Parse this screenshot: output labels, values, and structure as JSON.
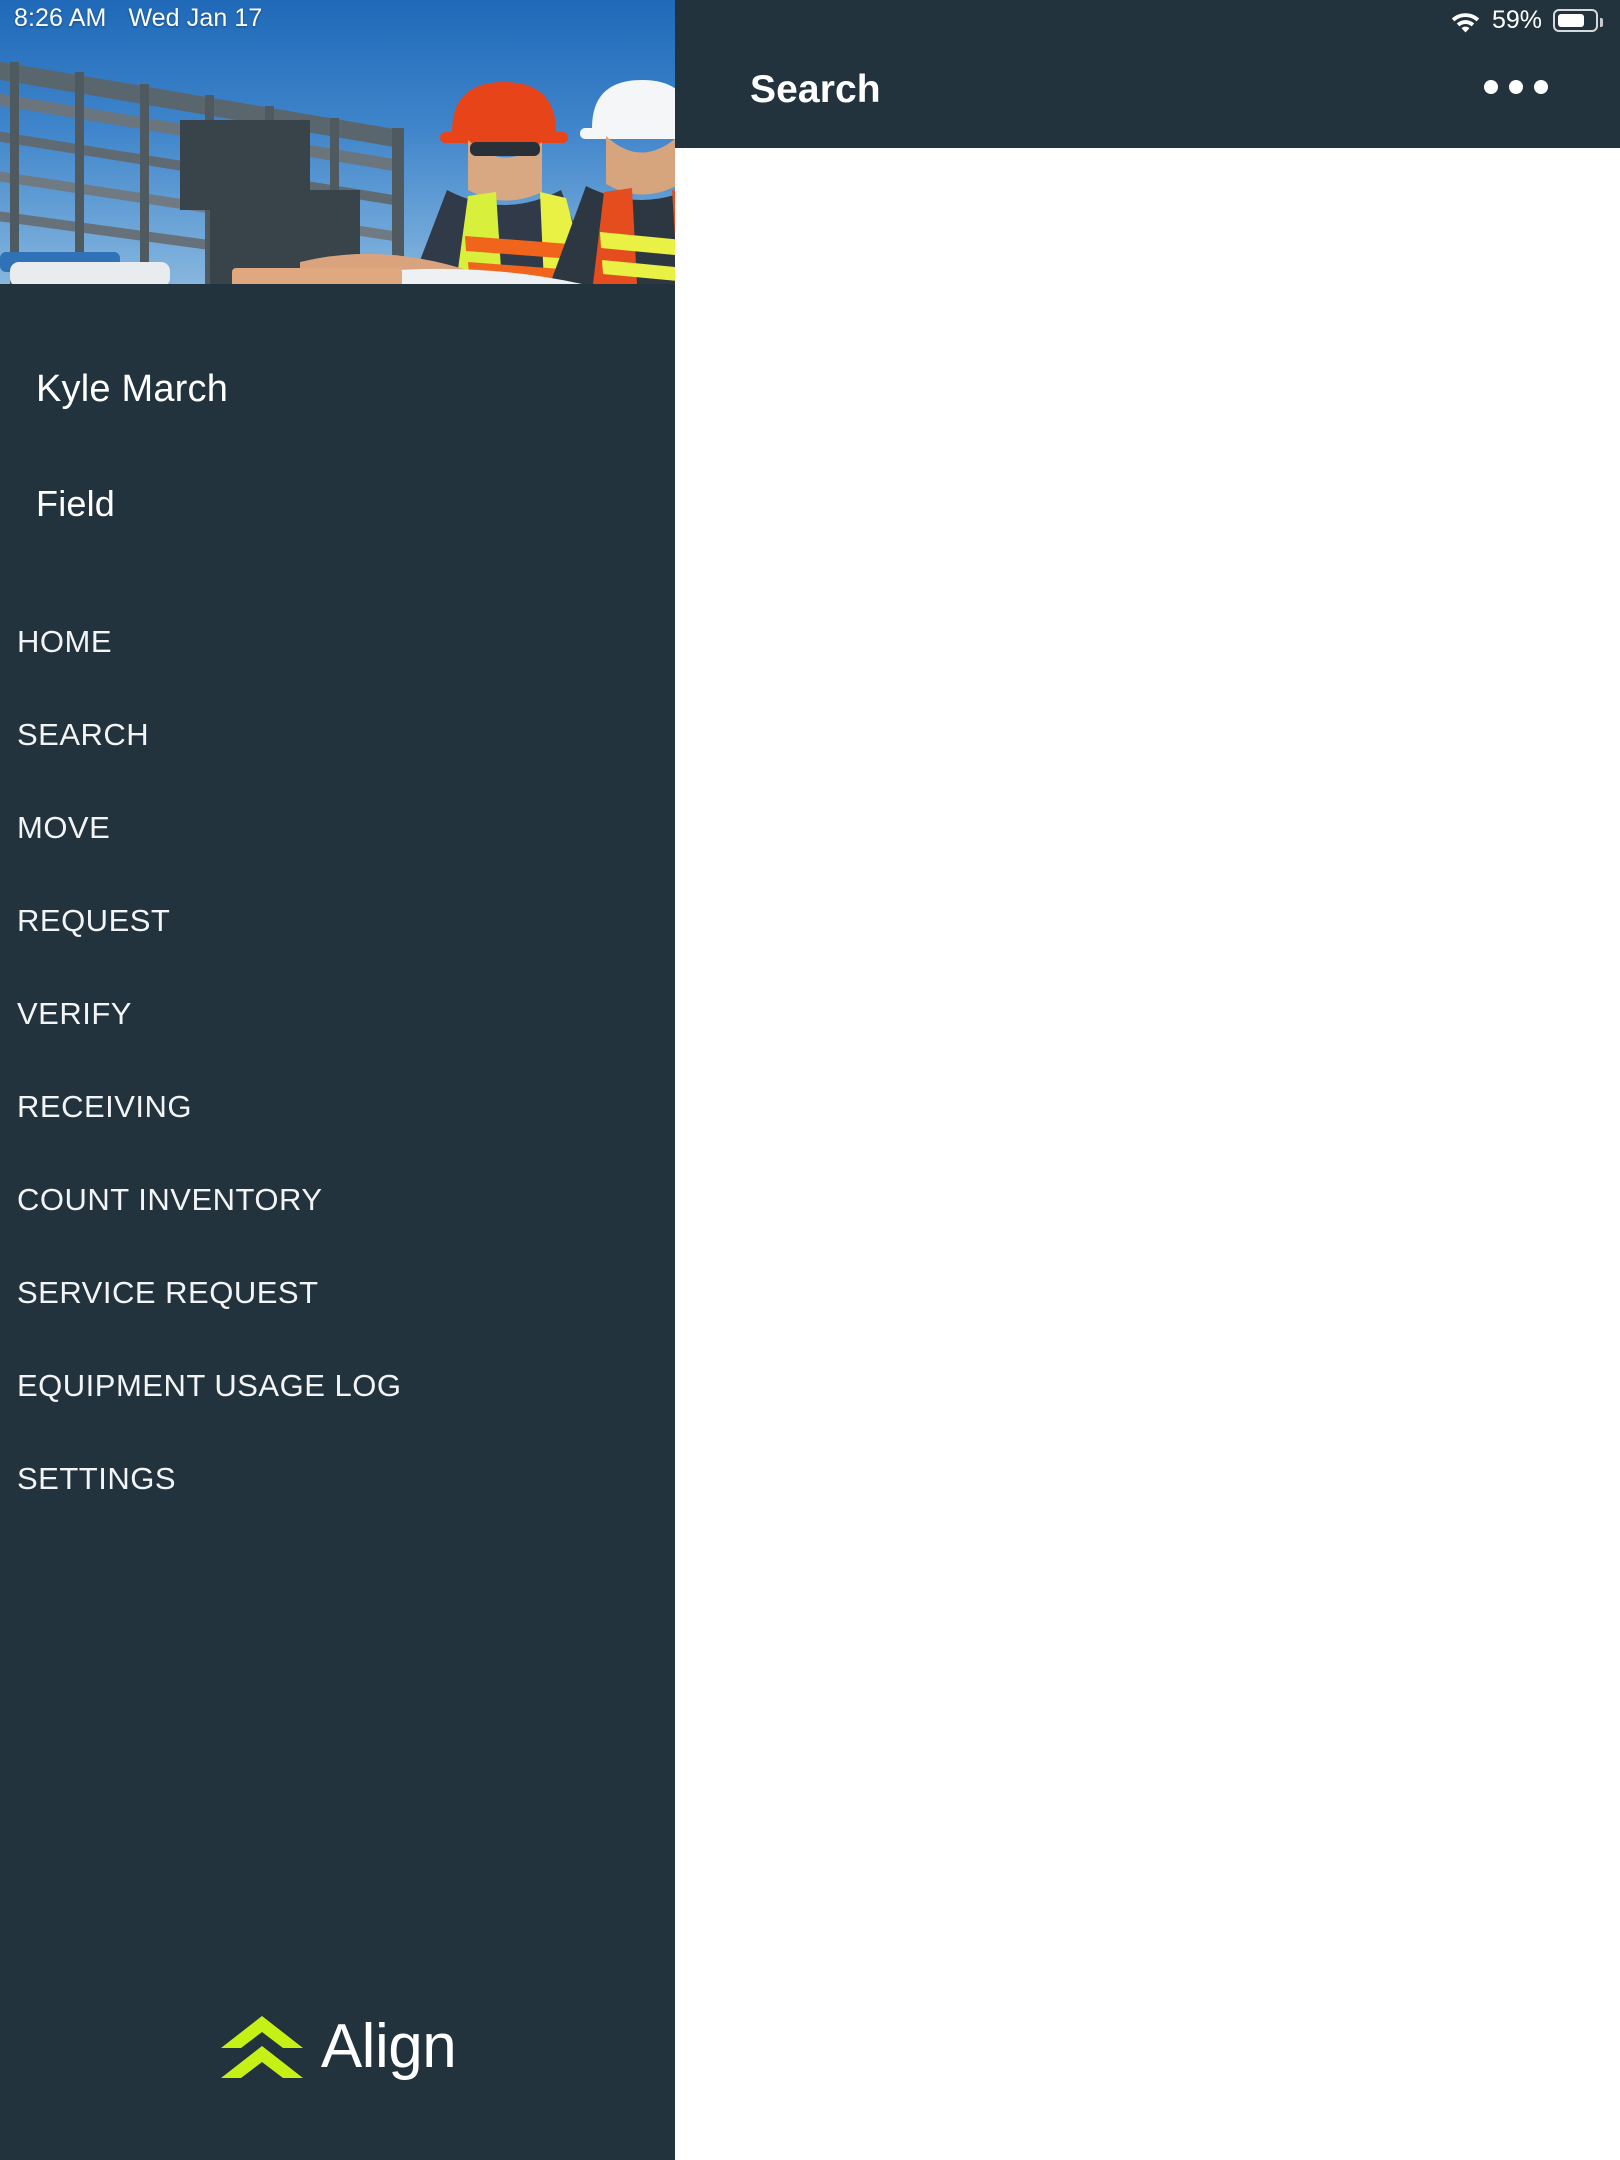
{
  "status_bar": {
    "time": "8:26 AM",
    "date": "Wed Jan 17",
    "battery_percent": "59%",
    "wifi_icon": "wifi-icon",
    "battery_icon": "battery-icon"
  },
  "sidebar": {
    "hero_image_alt": "construction-workers-photo",
    "user": {
      "name": "Kyle March",
      "role": "Field"
    },
    "nav_items": [
      {
        "label": "HOME",
        "name": "home"
      },
      {
        "label": "SEARCH",
        "name": "search"
      },
      {
        "label": "MOVE",
        "name": "move"
      },
      {
        "label": "REQUEST",
        "name": "request"
      },
      {
        "label": "VERIFY",
        "name": "verify"
      },
      {
        "label": "RECEIVING",
        "name": "receiving"
      },
      {
        "label": "COUNT INVENTORY",
        "name": "count-inventory"
      },
      {
        "label": "SERVICE REQUEST",
        "name": "service-request"
      },
      {
        "label": "EQUIPMENT USAGE LOG",
        "name": "equipment-usage-log"
      },
      {
        "label": "SETTINGS",
        "name": "settings"
      }
    ],
    "logo": {
      "text": "Align",
      "mark_icon": "align-chevron-logo-icon",
      "mark_color": "#c6f116",
      "text_color": "#ffffff"
    }
  },
  "header": {
    "title": "Search",
    "overflow_icon": "ellipsis-icon"
  },
  "main": {
    "content": ""
  },
  "colors": {
    "sidebar_background": "#22333d",
    "header_background": "#22333d",
    "content_background": "#ffffff",
    "accent_lime": "#c6f116",
    "text_primary": "#ffffff"
  }
}
